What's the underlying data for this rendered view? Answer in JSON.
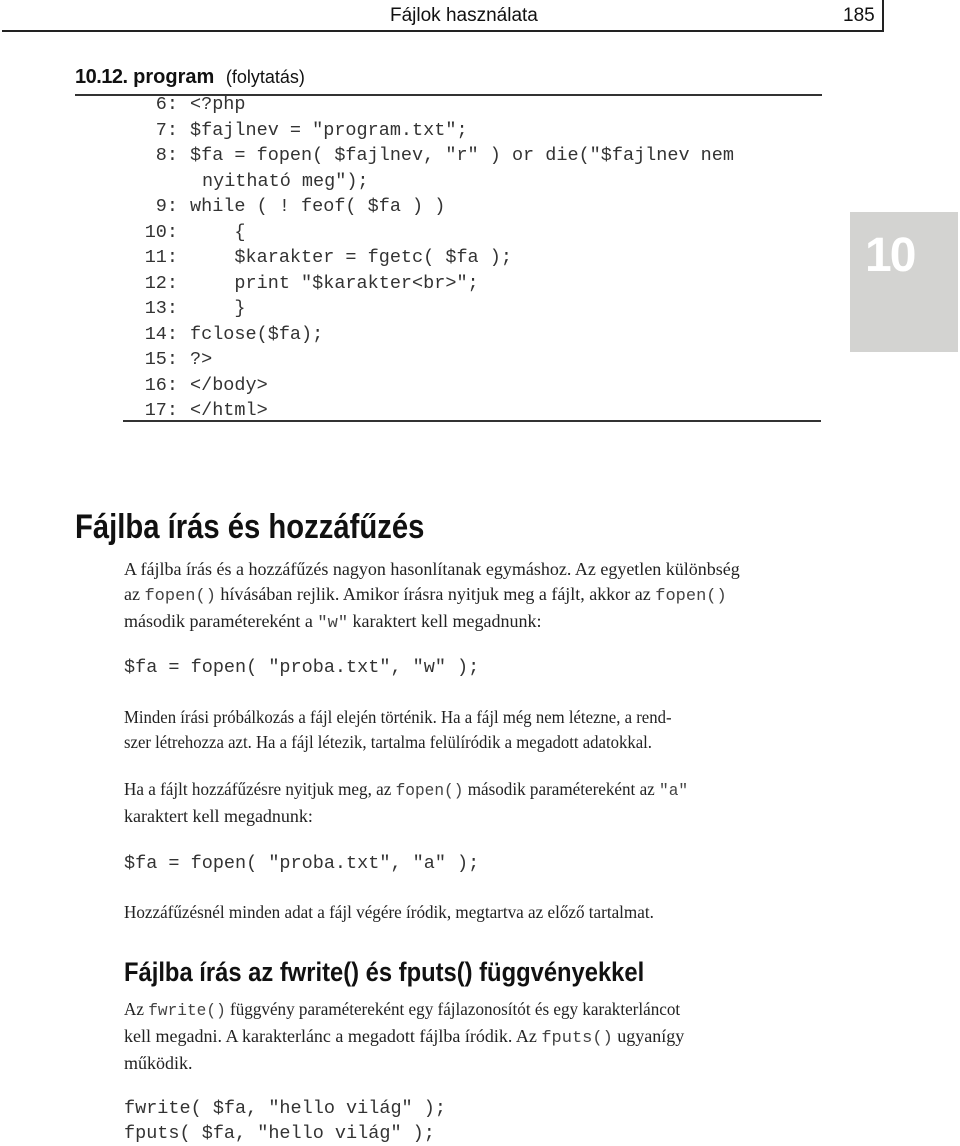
{
  "header": {
    "title": "Fájlok használata",
    "page_number": "185"
  },
  "chapter_tab": {
    "number": "10",
    "color": "#d3d3d1"
  },
  "listing": {
    "caption_number": "10.12.",
    "caption_word": "program",
    "caption_cont": "(folytatás)",
    "lines": [
      {
        "num": "6:",
        "src": "<?php"
      },
      {
        "num": "7:",
        "src": "$fajlnev = \"program.txt\";"
      },
      {
        "num": "8:",
        "src": "$fa = fopen( $fajlnev, \"r\" ) or die(\"$fajlnev nem"
      },
      {
        "num": "",
        "src": "nyitható meg\");"
      },
      {
        "num": "9:",
        "src": "while ( ! feof( $fa ) )"
      },
      {
        "num": "10:",
        "src": "    {"
      },
      {
        "num": "11:",
        "src": "    $karakter = fgetc( $fa );"
      },
      {
        "num": "12:",
        "src": "    print \"$karakter<br>\";"
      },
      {
        "num": "13:",
        "src": "    }"
      },
      {
        "num": "14:",
        "src": "fclose($fa);"
      },
      {
        "num": "15:",
        "src": "?>"
      },
      {
        "num": "16:",
        "src": "</body>"
      },
      {
        "num": "17:",
        "src": "</html>"
      }
    ]
  },
  "section1": {
    "heading": "Fájlba írás és hozzáfűzés",
    "p1": {
      "l1": "A fájlba írás és a hozzáfűzés nagyon hasonlítanak egymáshoz. Az egyetlen különbség",
      "l2a": "az ",
      "l2code": "fopen()",
      "l2b": " hívásában rejlik. Amikor írásra nyitjuk meg a fájlt, akkor az ",
      "l2code2": "fopen()",
      "l3a": "második paramétereként a ",
      "l3code": "\"w\"",
      "l3b": " karaktert kell megadnunk:"
    },
    "code_write": "$fa = fopen( \"proba.txt\", \"w\" );",
    "p2": {
      "l1": "Minden írási próbálkozás a fájl elején történik. Ha a fájl még nem létezne, a rend-",
      "l2": "szer létrehozza azt. Ha a fájl létezik, tartalma felülíródik a megadott adatokkal."
    },
    "p3": {
      "l1a": "Ha a fájlt hozzáfűzésre nyitjuk meg, az ",
      "l1code": "fopen()",
      "l1b": " második paramétereként az ",
      "l1code2": "\"a\"",
      "l2": "karaktert kell megadnunk:"
    },
    "code_append": "$fa = fopen( \"proba.txt\", \"a\" );",
    "p4": "Hozzáfűzésnél minden adat a fájl végére íródik, megtartva az előző tartalmat."
  },
  "section2": {
    "heading": "Fájlba írás az fwrite() és fputs() függvényekkel",
    "p1": {
      "l1a": "Az ",
      "l1code": "fwrite()",
      "l1b": " függvény paramétereként egy fájlazonosítót és egy karakterláncot",
      "l2a": "kell megadni. A karakterlánc a megadott fájlba íródik. Az ",
      "l2code": "fputs()",
      "l2b": " ugyanígy",
      "l3": "működik."
    },
    "code_fwrite": "fwrite( $fa, \"hello világ\" );",
    "code_fputs": "fputs( $fa, \"hello világ\" );"
  }
}
